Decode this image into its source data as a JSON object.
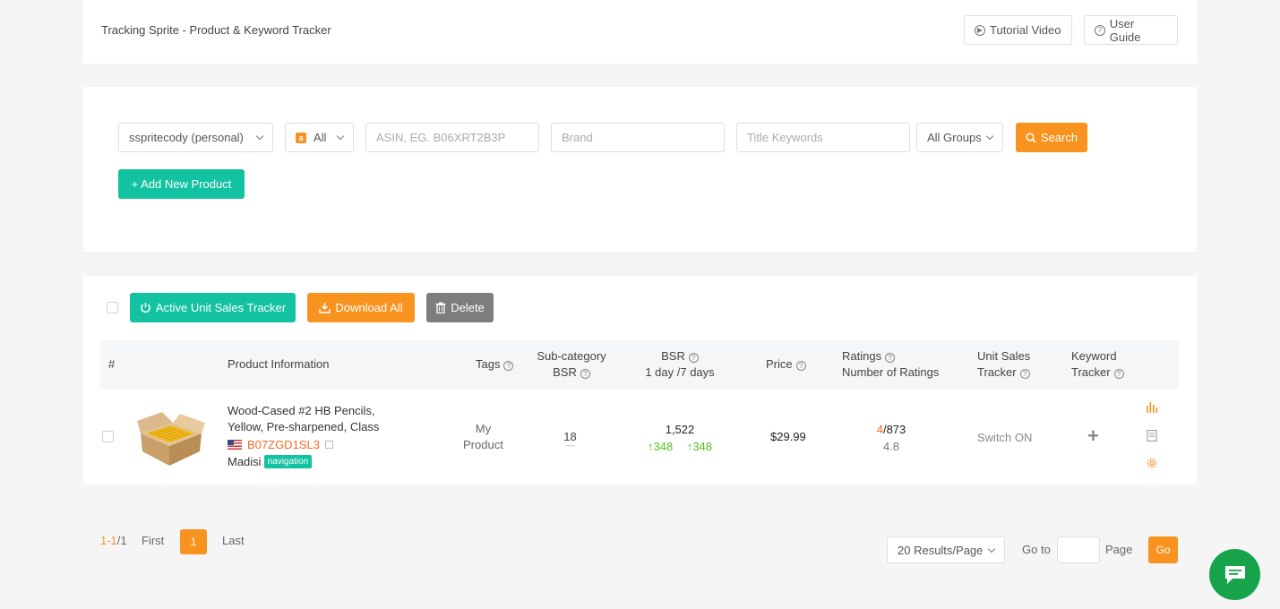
{
  "header": {
    "title": "Tracking Sprite - Product & Keyword Tracker",
    "tutorial_label": "Tutorial Video",
    "guide_label": "User Guide"
  },
  "filters": {
    "account": "sspritecody (personal)",
    "marketplace": "All",
    "asin_placeholder": "ASIN, EG. B06XRT2B3P",
    "brand_placeholder": "Brand",
    "title_placeholder": "Title Keywords",
    "group": "All Groups",
    "search_label": "Search",
    "add_label": "+ Add New Product"
  },
  "toolbar": {
    "active_tracker_label": "Active Unit Sales Tracker",
    "download_label": "Download All",
    "delete_label": "Delete"
  },
  "table": {
    "headers": {
      "index": "#",
      "product": "Product Information",
      "tags": "Tags",
      "subcat_1": "Sub-category",
      "subcat_2": "BSR",
      "bsr_1": "BSR",
      "bsr_2": "1 day /7 days",
      "price": "Price",
      "ratings_1": "Ratings",
      "ratings_2": "Number of Ratings",
      "unit_1": "Unit Sales",
      "unit_2": "Tracker",
      "kw_1": "Keyword",
      "kw_2": "Tracker"
    },
    "rows": [
      {
        "name_line1": "Wood-Cased #2 HB Pencils,",
        "name_line2": "Yellow, Pre-sharpened, Class",
        "asin": "B07ZGD1SL3",
        "brand": "Madisi",
        "brand_tag": "navigation",
        "tag_line1": "My",
        "tag_line2": "Product",
        "subcat_bsr": "18",
        "subcat_sub": "----",
        "bsr": "1,522",
        "bsr_1day": "348",
        "bsr_7days": "348",
        "price": "$29.99",
        "rating": "4",
        "num_ratings": "/873",
        "rating_avg": "4.8",
        "unit_tracker": "Switch ON",
        "keyword_tracker": "+"
      }
    ]
  },
  "pagination": {
    "range": "1-1",
    "total": "/1",
    "first": "First",
    "current": "1",
    "last": "Last",
    "per_page": "20 Results/Page",
    "goto": "Go to",
    "page": "Page",
    "go": "Go"
  },
  "colors": {
    "accent_orange": "#f7931e",
    "accent_teal": "#13c2a1",
    "up_green": "#52c41a",
    "chat_green": "#16a34a"
  }
}
